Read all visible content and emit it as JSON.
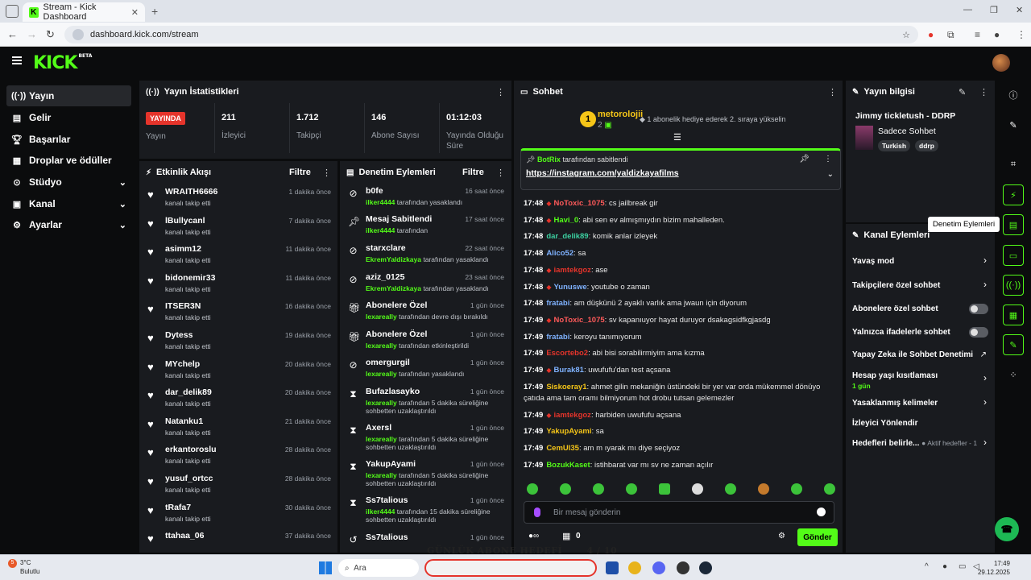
{
  "browser": {
    "tab_title": "Stream - Kick Dashboard",
    "url": "dashboard.kick.com/stream"
  },
  "app": {
    "logo": "KICK",
    "logo_badge": "BETA"
  },
  "sidebar": {
    "items": [
      {
        "label": "Yayın",
        "icon": "broadcast-icon"
      },
      {
        "label": "Gelir",
        "icon": "revenue-icon"
      },
      {
        "label": "Başarılar",
        "icon": "trophy-icon"
      },
      {
        "label": "Droplar ve ödüller",
        "icon": "gift-icon"
      },
      {
        "label": "Stüdyo",
        "icon": "studio-icon"
      },
      {
        "label": "Kanal",
        "icon": "channel-icon"
      },
      {
        "label": "Ayarlar",
        "icon": "settings-icon"
      }
    ]
  },
  "stats": {
    "title": "Yayın İstatistikleri",
    "live_badge": "YAYINDA",
    "live_label": "Yayın",
    "viewers_value": "211",
    "viewers_label": "İzleyici",
    "followers_value": "1.712",
    "followers_label": "Takipçi",
    "subs_value": "146",
    "subs_label": "Abone Sayısı",
    "uptime_value": "01:12:03",
    "uptime_label": "Yayında Olduğu Süre"
  },
  "activity": {
    "title": "Etkinlik Akışı",
    "filter": "Filtre",
    "items": [
      {
        "name": "WRAITH6666",
        "sub": "kanalı takip etti",
        "time": "1 dakika önce"
      },
      {
        "name": "lBullycanl",
        "sub": "kanalı takip etti",
        "time": "7 dakika önce"
      },
      {
        "name": "asimm12",
        "sub": "kanalı takip etti",
        "time": "11 dakika önce"
      },
      {
        "name": "bidonemir33",
        "sub": "kanalı takip etti",
        "time": "11 dakika önce"
      },
      {
        "name": "ITSER3N",
        "sub": "kanalı takip etti",
        "time": "16 dakika önce"
      },
      {
        "name": "Dytess",
        "sub": "kanalı takip etti",
        "time": "19 dakika önce"
      },
      {
        "name": "MYchelp",
        "sub": "kanalı takip etti",
        "time": "20 dakika önce"
      },
      {
        "name": "dar_delik89",
        "sub": "kanalı takip etti",
        "time": "20 dakika önce"
      },
      {
        "name": "Natanku1",
        "sub": "kanalı takip etti",
        "time": "21 dakika önce"
      },
      {
        "name": "erkantoroslu",
        "sub": "kanalı takip etti",
        "time": "28 dakika önce"
      },
      {
        "name": "yusuf_ortcc",
        "sub": "kanalı takip etti",
        "time": "28 dakika önce"
      },
      {
        "name": "tRafa7",
        "sub": "kanalı takip etti",
        "time": "30 dakika önce"
      },
      {
        "name": "ttahaa_06",
        "sub": "",
        "time": "37 dakika önce"
      }
    ]
  },
  "moderation": {
    "title": "Denetim Eylemleri",
    "filter": "Filtre",
    "items": [
      {
        "icon": "ban-icon",
        "name": "b0fe",
        "actor": "ilker4444",
        "rest": "tarafından yasaklandı",
        "time": "16 saat önce"
      },
      {
        "icon": "pin-icon",
        "name": "Mesaj Sabitlendi",
        "actor": "ilker4444",
        "rest": "tarafından",
        "time": "17 saat önce"
      },
      {
        "icon": "ban-icon",
        "name": "starxclare",
        "actor": "EkremYaldizkaya",
        "rest": "tarafından yasaklandı",
        "time": "22 saat önce"
      },
      {
        "icon": "ban-icon",
        "name": "aziz_0125",
        "actor": "EkremYaldizkaya",
        "rest": "tarafından yasaklandı",
        "time": "23 saat önce"
      },
      {
        "icon": "gift-icon",
        "name": "Abonelere Özel",
        "actor": "lexareally",
        "rest": "tarafından devre dışı bırakıldı",
        "time": "1 gün önce"
      },
      {
        "icon": "gift-icon",
        "name": "Abonelere Özel",
        "actor": "lexareally",
        "rest": "tarafından etkinleştirildi",
        "time": "1 gün önce"
      },
      {
        "icon": "ban-icon",
        "name": "omergurgil",
        "actor": "lexareally",
        "rest": "tarafından yasaklandı",
        "time": "1 gün önce"
      },
      {
        "icon": "hourglass-icon",
        "name": "Bufazlasayko",
        "actor": "lexareally",
        "rest": "tarafından 5 dakika süreliğine sohbetten uzaklaştırıldı",
        "time": "1 gün önce"
      },
      {
        "icon": "hourglass-icon",
        "name": "Axersl",
        "actor": "lexareally",
        "rest": "tarafından 5 dakika süreliğine sohbetten uzaklaştırıldı",
        "time": "1 gün önce"
      },
      {
        "icon": "hourglass-icon",
        "name": "YakupAyami",
        "actor": "lexareally",
        "rest": "tarafından 5 dakika süreliğine sohbetten uzaklaştırıldı",
        "time": "1 gün önce"
      },
      {
        "icon": "hourglass-icon",
        "name": "Ss7talious",
        "actor": "ilker4444",
        "rest": "tarafından 15 dakika süreliğine sohbetten uzaklaştırıldı",
        "time": "1 gün önce"
      },
      {
        "icon": "undo-icon",
        "name": "Ss7talious",
        "actor": "",
        "rest": "",
        "time": "1 gün önce"
      }
    ]
  },
  "chat": {
    "title": "Sohbet",
    "gifter_rank": "1",
    "gifter_name": "metorolojii",
    "gifter_count": "2",
    "gift_message": "1 abonelik hediye ederek 2. sıraya yükselin",
    "pinned_by_user": "BotRix",
    "pinned_by_rest": "tarafından sabitlendi",
    "pinned_link": "https://instagram.com/yaldizkayafilms",
    "messages": [
      {
        "time": "17:48",
        "user": "NoToxic_1075",
        "color": "#ff5a5a",
        "badge": true,
        "text": "cs jailbreak gir"
      },
      {
        "time": "17:48",
        "user": "Havi_0",
        "color": "#53fc18",
        "badge": true,
        "text": "abi sen ev almışmıydın bizim mahalleden."
      },
      {
        "time": "17:48",
        "user": "dar_delik89",
        "color": "#3ccfa0",
        "badge": false,
        "text": "komik anlar izleyek"
      },
      {
        "time": "17:48",
        "user": "Alico52",
        "color": "#7fb2ff",
        "badge": false,
        "text": "sa"
      },
      {
        "time": "17:48",
        "user": "iamtekgoz",
        "color": "#e5342b",
        "badge": true,
        "text": "ase"
      },
      {
        "time": "17:48",
        "user": "Yunuswe",
        "color": "#7fb2ff",
        "badge": true,
        "text": "youtube o zaman"
      },
      {
        "time": "17:48",
        "user": "fratabi",
        "color": "#7fb2ff",
        "badge": false,
        "text": "am düşkünü 2 ayaklı varlık ama jwaun için diyorum"
      },
      {
        "time": "17:49",
        "user": "NoToxic_1075",
        "color": "#ff5a5a",
        "badge": true,
        "text": "sv kapanıuyor hayat duruyor dsakagsidfkgjasdg"
      },
      {
        "time": "17:49",
        "user": "fratabi",
        "color": "#7fb2ff",
        "badge": false,
        "text": "keroyu tanımıyorum"
      },
      {
        "time": "17:49",
        "user": "Escortebo2",
        "color": "#e5342b",
        "badge": false,
        "text": "abi bisi sorabilirmiyim ama kızma"
      },
      {
        "time": "17:49",
        "user": "Burak81",
        "color": "#7fb2ff",
        "badge": true,
        "text": "uwufufu'dan test açsana"
      },
      {
        "time": "17:49",
        "user": "Siskoeray1",
        "color": "#f5c518",
        "badge": false,
        "text": "ahmet gilin mekaniğin üstündeki bir yer var orda mükemmel dönüyo çatıda ama tam oramı bilmiyorum hot drobu tutsan gelemezler"
      },
      {
        "time": "17:49",
        "user": "iamtekgoz",
        "color": "#e5342b",
        "badge": true,
        "text": "harbiden uwufufu açsana"
      },
      {
        "time": "17:49",
        "user": "YakupAyami",
        "color": "#f5c518",
        "badge": false,
        "text": "sa"
      },
      {
        "time": "17:49",
        "user": "CemUl35",
        "color": "#f5c518",
        "badge": false,
        "text": "am m ıyarak mı diye seçiyoz"
      },
      {
        "time": "17:49",
        "user": "BozukKaset",
        "color": "#53fc18",
        "badge": false,
        "text": "istihbarat var mı sv ne zaman açılır"
      }
    ],
    "input_placeholder": "Bir mesaj gönderin",
    "points": "0",
    "send_label": "Gönder"
  },
  "stream_info": {
    "title": "Yayın bilgisi",
    "stream_title": "Jimmy tickletush - DDRP",
    "category": "Sadece Sohbet",
    "tags": [
      "Turkish",
      "ddrp"
    ]
  },
  "channel_actions": {
    "title": "Kanal Eylemleri",
    "slow_mode": "Yavaş mod",
    "followers_only": "Takipçilere özel sohbet",
    "subs_only": "Abonelere özel sohbet",
    "emotes_only": "Yalnızca ifadelerle sohbet",
    "ai_moderation": "Yapay Zeka ile Sohbet Denetimi",
    "account_age": "Hesap yaşı kısıtlaması",
    "account_age_value": "1 gün",
    "banned_words": "Yasaklanmış kelimeler",
    "redirect": "İzleyici Yönlendir",
    "goals": "Hedefleri belirle...",
    "goals_active": "Aktif hedefler - 1"
  },
  "tooltip": "Denetim Eylemleri",
  "overlay": {
    "goal_label": "GÜNLÜK ABONE HEDEFİ",
    "goal_value": "4 / 10"
  },
  "taskbar": {
    "temp": "3°C",
    "weather": "Bulutlu",
    "weather_badge": "5",
    "search": "Ara",
    "time": "17:49",
    "date": "29.12.2025"
  }
}
